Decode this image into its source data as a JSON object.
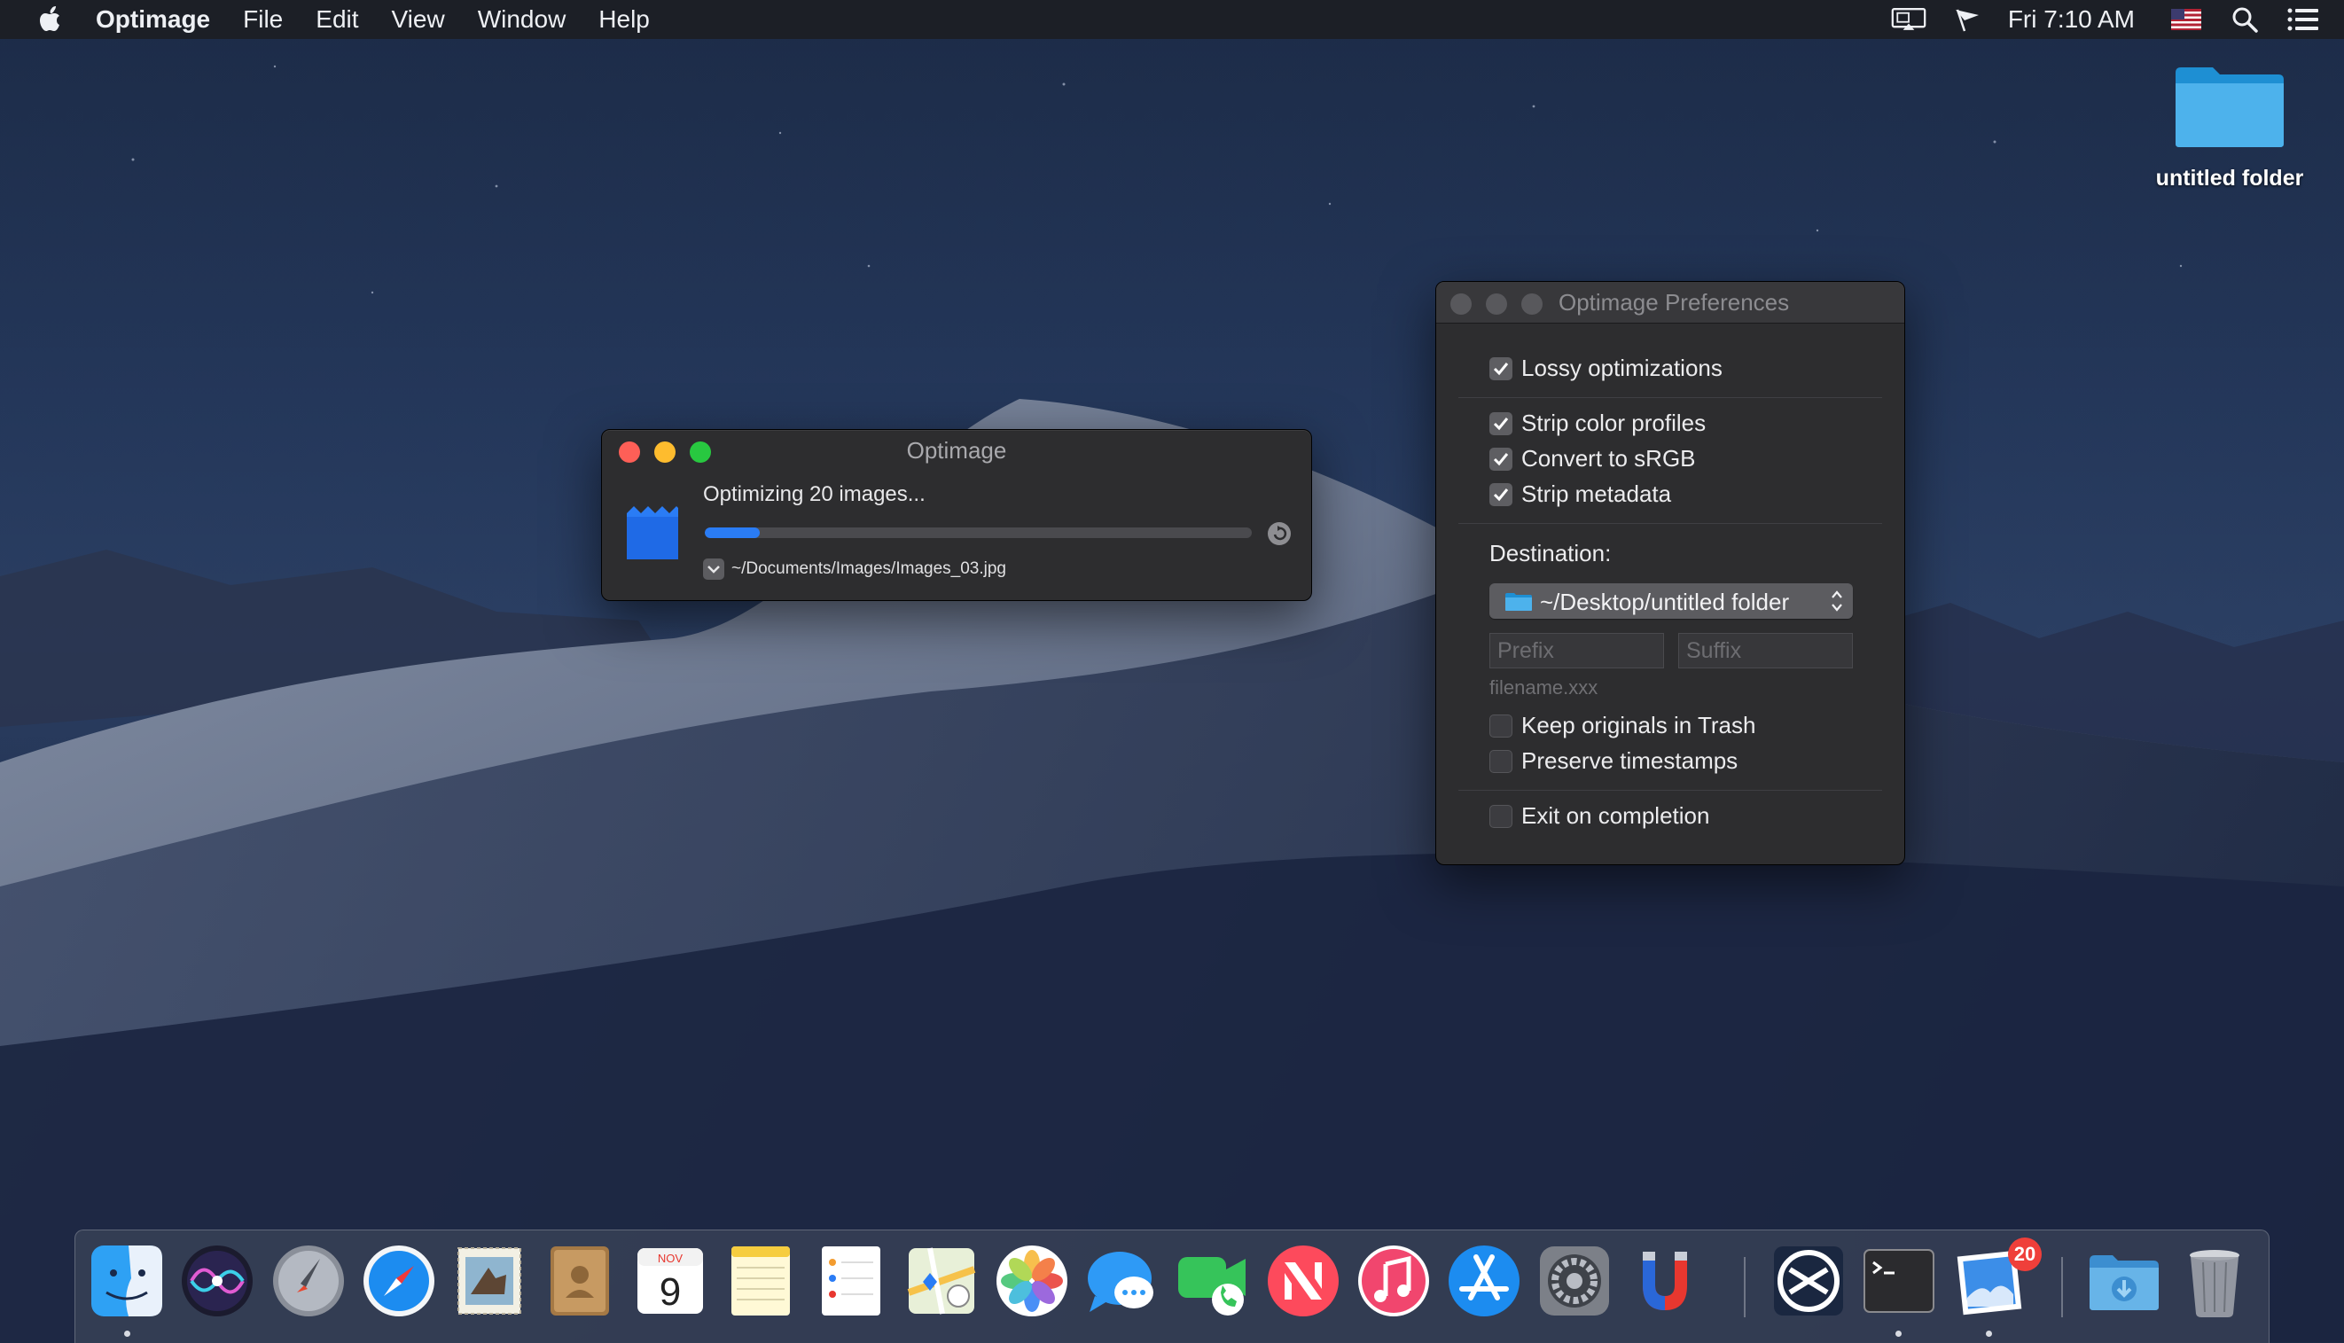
{
  "menubar": {
    "app_name": "Optimage",
    "menus": [
      "File",
      "Edit",
      "View",
      "Window",
      "Help"
    ],
    "clock": "Fri 7:10 AM",
    "status_icons": [
      "display-mirroring-icon",
      "flag-status-icon",
      "us-flag-input-icon",
      "spotlight-search-icon",
      "notification-center-icon"
    ]
  },
  "desktop": {
    "folder_label": "untitled folder"
  },
  "optimage_window": {
    "title": "Optimage",
    "status": "Optimizing 20 images...",
    "progress": 0.1,
    "current_file": "~/Documents/Images/Images_03.jpg"
  },
  "preferences": {
    "title": "Optimage Preferences",
    "lossy": {
      "label": "Lossy optimizations",
      "checked": true
    },
    "strip_color_profiles": {
      "label": "Strip color profiles",
      "checked": true
    },
    "convert_srgb": {
      "label": "Convert to sRGB",
      "checked": true
    },
    "strip_metadata": {
      "label": "Strip metadata",
      "checked": true
    },
    "destination_label": "Destination:",
    "destination_value": "~/Desktop/untitled folder",
    "prefix_placeholder": "Prefix",
    "suffix_placeholder": "Suffix",
    "filename_hint": "filename.xxx",
    "keep_originals": {
      "label": "Keep originals in Trash",
      "checked": false
    },
    "preserve_timestamps": {
      "label": "Preserve timestamps",
      "checked": false
    },
    "exit_on_completion": {
      "label": "Exit on completion",
      "checked": false
    }
  },
  "dock": {
    "calendar_month": "NOV",
    "calendar_day": "9",
    "badge_count": "20",
    "apps": [
      "Finder",
      "Siri",
      "Launchpad",
      "Safari",
      "Mail",
      "Contacts",
      "Calendar",
      "Notes",
      "Reminders",
      "Maps",
      "Photos",
      "Messages",
      "FaceTime",
      "News",
      "iTunes",
      "App Store",
      "System Preferences",
      "Magnet",
      "Optimage",
      "Terminal",
      "Preview",
      "Downloads",
      "Trash"
    ]
  },
  "colors": {
    "accent": "#2a7cf5",
    "close": "#fe5f57",
    "minimize": "#febc2e",
    "zoom": "#28c840"
  }
}
